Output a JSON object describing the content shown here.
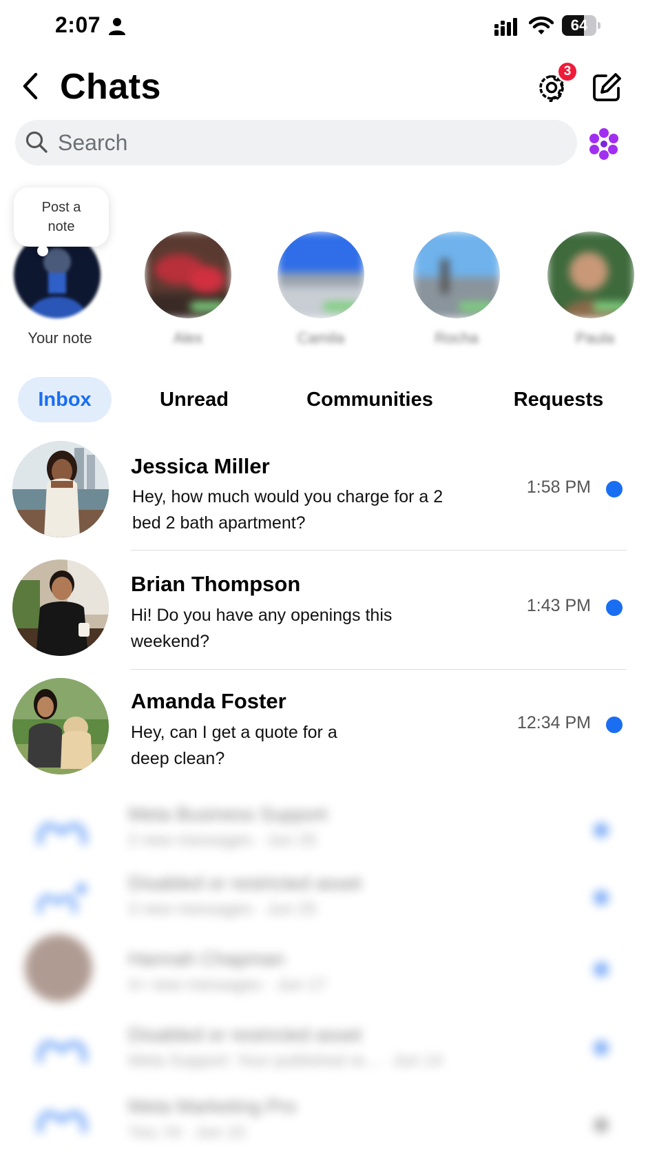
{
  "status_bar": {
    "time": "2:07",
    "battery": "64",
    "battery_level": 0.64
  },
  "header": {
    "title": "Chats",
    "settings_badge": "3"
  },
  "search": {
    "placeholder": "Search"
  },
  "notes": {
    "prompt": "Post a note",
    "items": [
      {
        "label": "Your note"
      },
      {
        "label": "Alex"
      },
      {
        "label": "Camila"
      },
      {
        "label": "Rocha"
      },
      {
        "label": "Paula"
      }
    ]
  },
  "tabs": [
    {
      "label": "Inbox",
      "active": true
    },
    {
      "label": "Unread",
      "active": false
    },
    {
      "label": "Communities",
      "active": false
    },
    {
      "label": "Requests",
      "active": false
    }
  ],
  "chats": [
    {
      "name": "Jessica Miller",
      "preview": "Hey, how much would you charge for a 2 bed 2 bath apartment?",
      "time": "1:58 PM",
      "unread": true
    },
    {
      "name": "Brian Thompson",
      "preview": "Hi! Do you have any openings this weekend?",
      "time": "1:43 PM",
      "unread": true
    },
    {
      "name": "Amanda Foster",
      "preview": "Hey, can I get a quote for a deep clean?",
      "time": "12:34 PM",
      "unread": true
    }
  ],
  "blurred_chats": [
    {
      "name": "Meta Business Support",
      "subtitle": "2 new messages · Jun 25"
    },
    {
      "name": "Disabled or restricted asset",
      "subtitle": "3 new messages · Jun 25"
    },
    {
      "name": "Hannah Chapman",
      "subtitle": "4+ new messages · Jun 17"
    },
    {
      "name": "Disabled or restricted asset",
      "subtitle": "Meta Support: Your published re... · Jun 14"
    },
    {
      "name": "Meta Marketing Pro",
      "subtitle": "You: Hi · Jun 10"
    }
  ],
  "colors": {
    "accent": "#1a6ef2",
    "badge": "#ee1c39",
    "tab_active_bg": "#e2edfc",
    "search_bg": "#f0f1f3"
  }
}
